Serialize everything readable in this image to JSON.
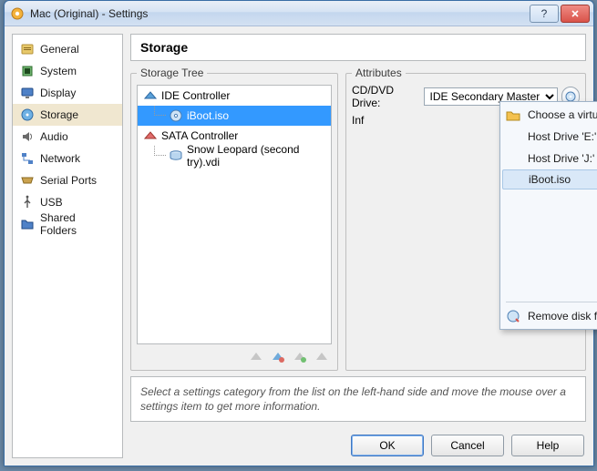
{
  "window": {
    "title": "Mac (Original) - Settings"
  },
  "sidebar": {
    "items": [
      {
        "label": "General"
      },
      {
        "label": "System"
      },
      {
        "label": "Display"
      },
      {
        "label": "Storage"
      },
      {
        "label": "Audio"
      },
      {
        "label": "Network"
      },
      {
        "label": "Serial Ports"
      },
      {
        "label": "USB"
      },
      {
        "label": "Shared Folders"
      }
    ],
    "selected_index": 3
  },
  "header": {
    "title": "Storage"
  },
  "panels": {
    "tree_legend": "Storage Tree",
    "attr_legend": "Attributes"
  },
  "tree": {
    "rows": [
      {
        "label": "IDE Controller"
      },
      {
        "label": "iBoot.iso"
      },
      {
        "label": "SATA Controller"
      },
      {
        "label": "Snow Leopard (second try).vdi"
      }
    ],
    "selected_index": 1
  },
  "attributes": {
    "drive_label": "CD/DVD Drive:",
    "drive_value": "IDE Secondary Master",
    "info_label_truncated": "Inf"
  },
  "menu": {
    "items": [
      {
        "label": "Choose a virtual CD/DVD disk file..."
      },
      {
        "label": "Host Drive 'E:'"
      },
      {
        "label": "Host Drive 'J:'"
      },
      {
        "label": "iBoot.iso"
      }
    ],
    "hover_index": 3,
    "remove_label": "Remove disk from virtual drive"
  },
  "hint": "Select a settings category from the list on the left-hand side and move the mouse over a settings item to get more information.",
  "buttons": {
    "ok": "OK",
    "cancel": "Cancel",
    "help": "Help"
  }
}
